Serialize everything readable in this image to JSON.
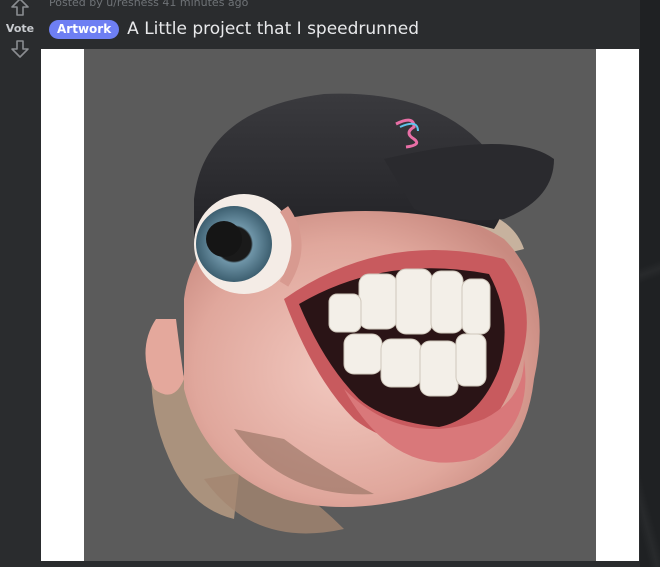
{
  "post": {
    "posted_by": "Posted by u/resness 41 minutes ago",
    "vote_label": "Vote",
    "flair": "Artwork",
    "title": "A Little project that I speedrunned"
  },
  "colors": {
    "flair_bg": "#6e7ff3",
    "panel_bg": "#2a2c2e",
    "artwork_bg": "#5b5b5b"
  },
  "icons": {
    "upvote": "arrow-up-outline-icon",
    "downvote": "arrow-down-outline-icon"
  }
}
